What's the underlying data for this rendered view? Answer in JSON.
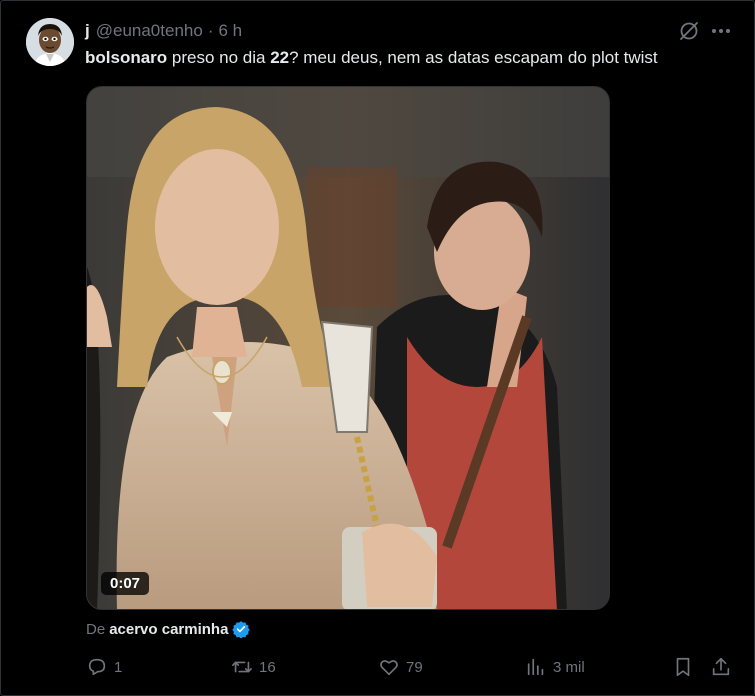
{
  "tweet": {
    "author": {
      "display_name": "j",
      "handle": "@euna0tenho",
      "separator": "·",
      "time": "6 h"
    },
    "text_parts": {
      "bold_1": "bolsonaro",
      "plain_1": " preso no dia ",
      "bold_2": "22",
      "plain_2": "? meu deus, nem as datas escapam do plot twist"
    },
    "media": {
      "type": "video",
      "duration": "0:07"
    },
    "source": {
      "prefix": "De",
      "name": "acervo carminha",
      "verified": true
    },
    "actions": {
      "replies": "1",
      "reposts": "16",
      "likes": "79",
      "views": "3 mil"
    }
  },
  "colors": {
    "background": "#000000",
    "text": "#e7e9ea",
    "muted": "#71767b",
    "verified": "#1d9bf0"
  },
  "icons": [
    "grok-icon",
    "more-icon",
    "reply-icon",
    "repost-icon",
    "like-icon",
    "views-icon",
    "bookmark-icon",
    "share-icon",
    "verified-badge-icon"
  ]
}
